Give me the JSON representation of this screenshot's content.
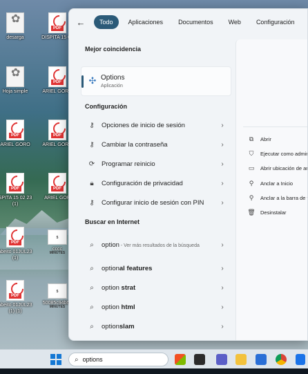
{
  "desktop": {
    "icons": [
      {
        "label": "desarga",
        "type": "leaf"
      },
      {
        "label": "DISPITA 15 02",
        "type": "pdf"
      },
      {
        "label": "Hoja simple",
        "type": "leaf"
      },
      {
        "label": "ARIEL GORO",
        "type": "pdf"
      },
      {
        "label": "ARIEL GORO",
        "type": "pdf"
      },
      {
        "label": "ARIEL GORO",
        "type": "pdf"
      },
      {
        "label": "SPITA 15 02 23 (1)",
        "type": "pdf"
      },
      {
        "label": "ARIEL GOR",
        "type": "pdf"
      },
      {
        "label": "abeito 01JUL23 (1)",
        "type": "pdf"
      },
      {
        "label": "cccc",
        "type": "img"
      },
      {
        "label": "abeito 01JUL23 (1) (1)",
        "type": "pdf"
      },
      {
        "label": "50085c94b63",
        "type": "img"
      }
    ],
    "pdf_tag": "PDF",
    "img_tag": "5 MINUTES"
  },
  "start_menu": {
    "tabs": [
      "Todo",
      "Aplicaciones",
      "Documentos",
      "Web",
      "Configuración"
    ],
    "active_tab": "Todo",
    "best_match_heading": "Mejor coincidencia",
    "best_match": {
      "title": "Options",
      "subtitle": "Aplicación",
      "icon": "options-app-icon"
    },
    "config_heading": "Configuración",
    "config_items": [
      {
        "label": "Opciones de inicio de sesión",
        "icon": "key-icon"
      },
      {
        "label": "Cambiar la contraseña",
        "icon": "key-icon"
      },
      {
        "label": "Programar reinicio",
        "icon": "refresh-icon"
      },
      {
        "label": "Configuración de privacidad",
        "icon": "lock-icon"
      },
      {
        "label": "Configurar inicio de sesión con PIN",
        "icon": "key-icon"
      }
    ],
    "web_heading": "Buscar en Internet",
    "web_items": [
      {
        "prefix": "option",
        "suffix": "",
        "hint": " - Ver más resultados de la búsqueda"
      },
      {
        "prefix": "option",
        "suffix": "al features",
        "hint": ""
      },
      {
        "prefix": "option",
        "suffix": " strat",
        "hint": ""
      },
      {
        "prefix": "option",
        "suffix": " html",
        "hint": ""
      },
      {
        "prefix": "option",
        "suffix": "slam",
        "hint": ""
      }
    ],
    "actions": [
      {
        "label": "Abrir",
        "icon": "open-icon"
      },
      {
        "label": "Ejecutar como administrador",
        "icon": "admin-shield-icon"
      },
      {
        "label": "Abrir ubicación de archivo",
        "icon": "folder-icon"
      },
      {
        "label": "Anclar a Inicio",
        "icon": "pin-icon"
      },
      {
        "label": "Anclar a la barra de tareas",
        "icon": "pin-icon"
      },
      {
        "label": "Desinstalar",
        "icon": "trash-icon"
      }
    ]
  },
  "taskbar": {
    "search_value": "options",
    "apps": [
      "store-icon",
      "desktop-icon",
      "teams-icon",
      "explorer-icon",
      "ms-store-icon",
      "chrome-icon",
      "mail-icon"
    ]
  }
}
